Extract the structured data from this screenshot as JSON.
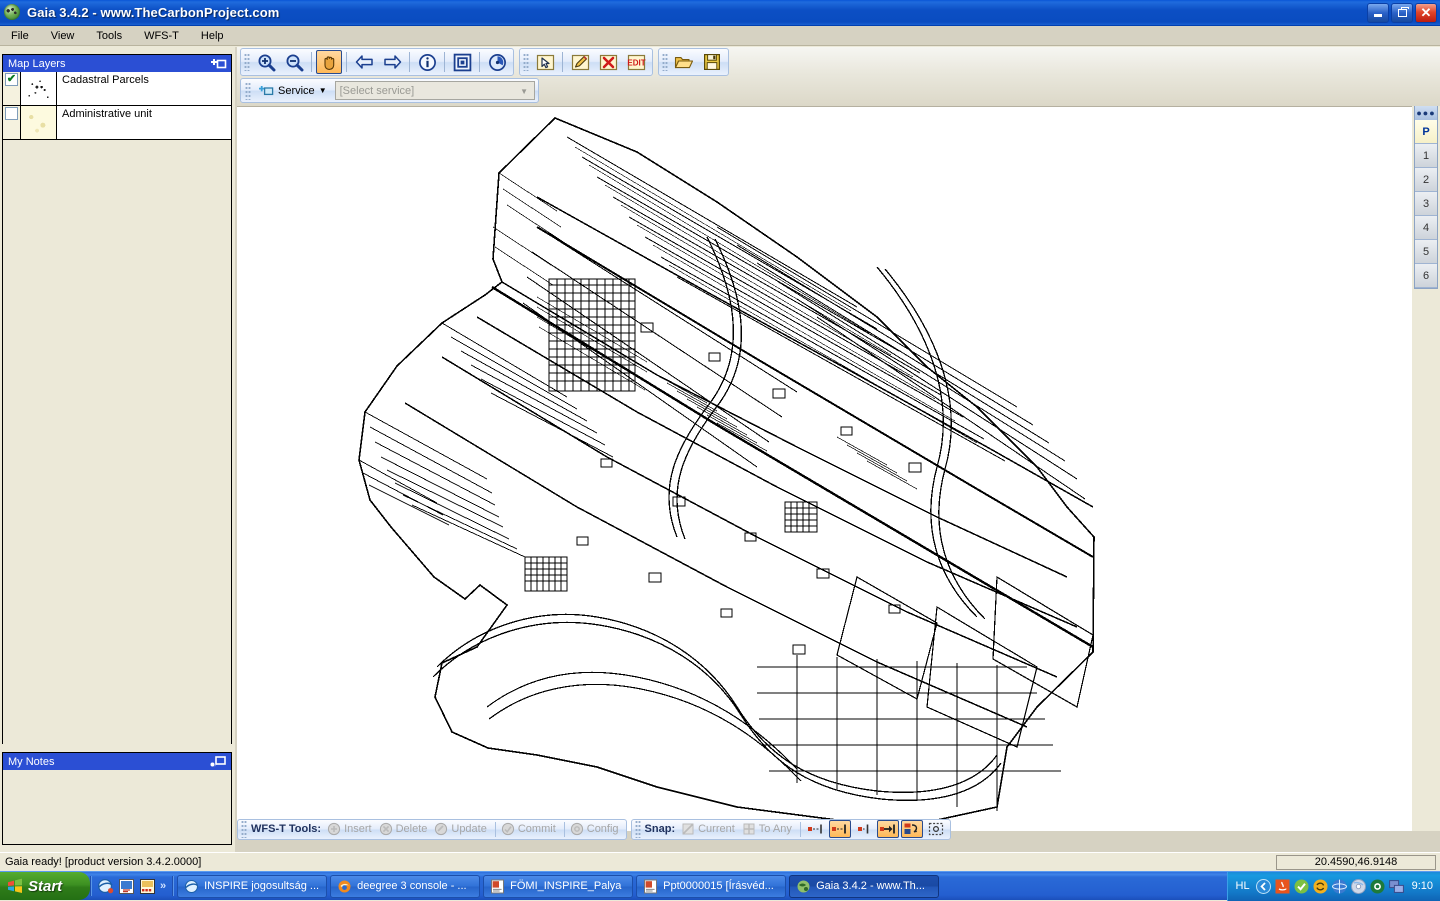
{
  "window": {
    "title": "Gaia 3.4.2 - www.TheCarbonProject.com",
    "app_icon": "globe-icon",
    "controls": {
      "minimize": "minimize-button",
      "maximize": "maximize-button",
      "close": "close-button"
    }
  },
  "menubar": {
    "items": [
      {
        "label": "File"
      },
      {
        "label": "View"
      },
      {
        "label": "Tools"
      },
      {
        "label": "WFS-T"
      },
      {
        "label": "Help"
      }
    ]
  },
  "toolbar": {
    "navigation": [
      {
        "name": "zoom-in-icon",
        "label": "Zoom In",
        "active": false
      },
      {
        "name": "zoom-out-icon",
        "label": "Zoom Out",
        "active": false
      },
      {
        "name": "pan-hand-icon",
        "label": "Pan",
        "active": true
      },
      {
        "name": "back-arrow-icon",
        "label": "Previous Extent",
        "active": false
      },
      {
        "name": "forward-arrow-icon",
        "label": "Next Extent",
        "active": false
      },
      {
        "name": "identify-info-icon",
        "label": "Identify",
        "active": false
      },
      {
        "name": "zoom-full-extent-icon",
        "label": "Full Extent",
        "active": false
      },
      {
        "name": "refresh-globe-icon",
        "label": "Refresh",
        "active": false
      }
    ],
    "editing": [
      {
        "name": "select-feature-icon",
        "label": "Select"
      },
      {
        "name": "edit-pencil-icon",
        "label": "Edit"
      },
      {
        "name": "delete-feature-icon",
        "label": "Delete"
      },
      {
        "name": "edit-attributes-icon",
        "label": "EDIT"
      }
    ],
    "file": [
      {
        "name": "open-folder-icon",
        "label": "Open"
      },
      {
        "name": "save-disk-icon",
        "label": "Save"
      }
    ],
    "service": {
      "button_label": "Service",
      "button_icon": "add-service-icon",
      "combo_placeholder": "[Select service]",
      "combo_value": ""
    }
  },
  "layers_panel": {
    "title": "Map Layers",
    "tool_icon": "add-layer-icon",
    "layers": [
      {
        "name": "Cadastral Parcels",
        "checked": true,
        "symbol": "parcels-symbol"
      },
      {
        "name": "Administrative unit",
        "checked": false,
        "symbol": "admin-unit-symbol"
      }
    ]
  },
  "notes_panel": {
    "title": "My Notes",
    "tool_icon": "add-note-icon",
    "content": ""
  },
  "right_tabs": {
    "handle_icon": "tab-grip-icon",
    "tabs": [
      {
        "label": "P",
        "selected": true
      },
      {
        "label": "1",
        "selected": false
      },
      {
        "label": "2",
        "selected": false
      },
      {
        "label": "3",
        "selected": false
      },
      {
        "label": "4",
        "selected": false
      },
      {
        "label": "5",
        "selected": false
      },
      {
        "label": "6",
        "selected": false
      }
    ]
  },
  "wfst_bar": {
    "tools_label": "WFS-T Tools:",
    "actions": [
      {
        "label": "Insert",
        "icon": "insert-icon",
        "enabled": false
      },
      {
        "label": "Delete",
        "icon": "delete-icon",
        "enabled": false
      },
      {
        "label": "Update",
        "icon": "update-icon",
        "enabled": false
      },
      {
        "label": "Commit",
        "icon": "commit-icon",
        "enabled": false
      },
      {
        "label": "Config",
        "icon": "config-icon",
        "enabled": false
      }
    ],
    "snap_label": "Snap:",
    "snap_modes": [
      {
        "label": "Current",
        "icon": "snap-current-icon",
        "enabled": false
      },
      {
        "label": "To Any",
        "icon": "snap-to-any-icon",
        "enabled": false
      }
    ],
    "snap_buttons": [
      {
        "name": "snap-end-left-icon",
        "active": false
      },
      {
        "name": "snap-segment-icon",
        "active": true
      },
      {
        "name": "snap-node-icon",
        "active": false
      },
      {
        "name": "snap-vertex-icon",
        "active": true
      },
      {
        "name": "snap-settings-icon",
        "active": true
      },
      {
        "name": "snap-extent-icon",
        "active": false
      }
    ]
  },
  "statusbar": {
    "message": "Gaia ready! [product version 3.4.2.0000]",
    "coordinates": "20.4590,46.9148"
  },
  "taskbar": {
    "start_label": "Start",
    "quicklaunch": [
      {
        "name": "ie-launch-icon"
      },
      {
        "name": "show-desktop-icon"
      },
      {
        "name": "media-launch-icon"
      }
    ],
    "quicklaunch_more": "»",
    "tasks": [
      {
        "label": "INSPIRE jogosultság ...",
        "icon": "ie-window-icon",
        "active": false
      },
      {
        "label": "deegree 3 console - ...",
        "icon": "firefox-window-icon",
        "active": false
      },
      {
        "label": "FÖMI_INSPIRE_Palya",
        "icon": "powerpoint-window-icon",
        "active": false
      },
      {
        "label": "Ppt0000015 [Írásvéd...",
        "icon": "powerpoint-window-icon",
        "active": false
      },
      {
        "label": "Gaia 3.4.2 - www.Th...",
        "icon": "gaia-window-icon",
        "active": true
      }
    ],
    "tray": {
      "language": "HL",
      "icons": [
        {
          "name": "tray-chevron-icon"
        },
        {
          "name": "java-tray-icon"
        },
        {
          "name": "check-tray-icon"
        },
        {
          "name": "update-tray-icon"
        },
        {
          "name": "network-tray-icon"
        },
        {
          "name": "cd-tray-icon"
        },
        {
          "name": "antivirus-tray-icon"
        },
        {
          "name": "display-tray-icon"
        }
      ],
      "clock": "9:10"
    }
  },
  "map": {
    "description": "Cadastral parcel vector map of a Hungarian settlement",
    "background": "#ffffff",
    "line_color": "#000000"
  },
  "colors": {
    "title_bar": "#0a4cc0",
    "panel_title": "#2b4fd4",
    "window_bg": "#ece9d8",
    "toolbar_accent": "#ffb958",
    "taskbar": "#245fd0",
    "start_green": "#3d9022"
  }
}
